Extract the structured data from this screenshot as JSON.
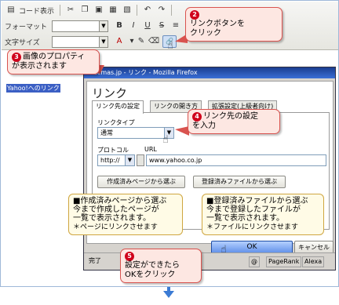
{
  "toolbar": {
    "code_view_label": "コード表示",
    "format_label": "フォーマット",
    "font_size_label": "文字サイズ",
    "bold_icon_text": "B",
    "italic_icon_text": "I",
    "underline_icon_text": "U"
  },
  "editor": {
    "yahoo_link_text": "Yahoo!へのリンク"
  },
  "firefox": {
    "title": "ecmas.jp - リンク - Mozilla Firefox",
    "dialog_title": "リンク",
    "tabs": [
      "リンク先の設定",
      "リンクの開き方",
      "拡張設定(上級者向け)"
    ],
    "link_type_label": "リンクタイプ",
    "link_type_value": "通常",
    "protocol_label": "プロトコル",
    "protocol_value": "http://",
    "url_label": "URL",
    "url_value": "www.yahoo.co.jp",
    "choose_page_button": "作成済みページから選ぶ",
    "choose_file_button": "登録済みファイルから選ぶ",
    "ok_button": "OK",
    "cancel_button": "キャンセル",
    "status_done": "完了",
    "pagerank_label": "PageRank",
    "alexa_label": "Alexa"
  },
  "callouts": {
    "c2": {
      "num": "2",
      "line1": "リンクボタンを",
      "line2": "クリック"
    },
    "c3": {
      "num": "3",
      "line1": "画像のプロパティ",
      "line2": "が表示されます"
    },
    "c4": {
      "num": "4",
      "line1": "リンク先の設定",
      "line2": "を入力"
    },
    "c5": {
      "num": "5",
      "line1": "設定ができたら",
      "line2": "OKをクリック"
    },
    "note_page": {
      "line1": "■作成済みページから選ぶ",
      "line2": "今まで作成したページが",
      "line3": "一覧で表示されます。",
      "line4": "＊ページにリンクさせます"
    },
    "note_file": {
      "line1": "■登録済みファイルから選ぶ",
      "line2": "今まで登録したファイルが",
      "line3": "一覧で表示されます。",
      "line4": "＊ファイルにリンクさせます"
    }
  },
  "colors": {
    "callout_border": "#d9534f",
    "callout_bg": "#fde7e2",
    "number_badge": "#d0021b",
    "note_bg": "#fffbe6",
    "ok_button": "#5f8fe8",
    "title_bar": "#1a3d8f"
  }
}
